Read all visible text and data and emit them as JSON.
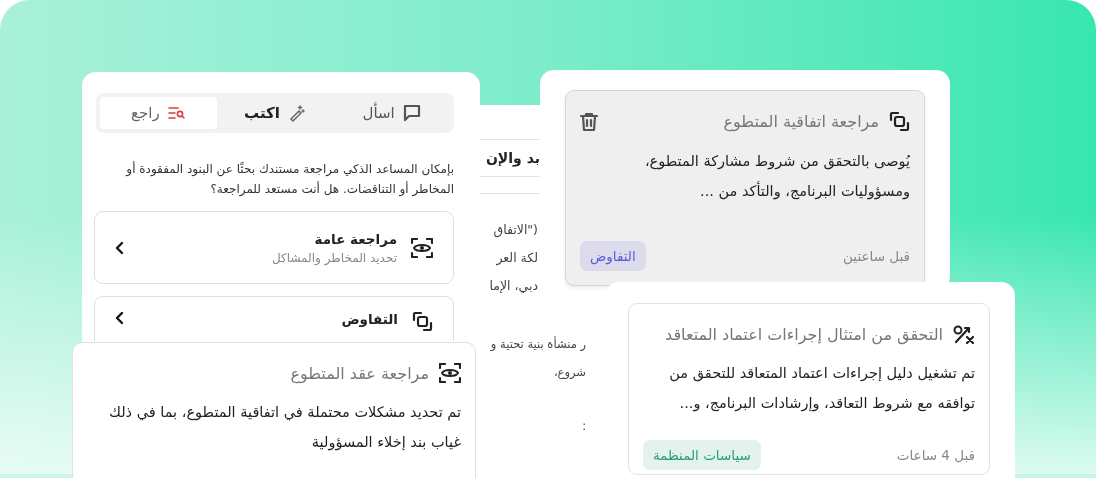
{
  "assistant_panel": {
    "tabs": [
      {
        "label": "اسأل",
        "kind": "chat",
        "selected": false
      },
      {
        "label": "اكتب",
        "kind": "wand",
        "selected": false
      },
      {
        "label": "راجع",
        "kind": "review",
        "selected": true
      }
    ],
    "description": "بإمكان المساعد الذكي مراجعة مستندك بحثًا عن البنود المفقودة أو المخاطر أو التناقضات. هل أنت مستعد للمراجعة؟",
    "options": [
      {
        "title": "مراجعة عامة",
        "subtitle": "تحديد المخاطر والمشاكل",
        "kind": "eye"
      },
      {
        "title": "التفاوض",
        "kind": "link"
      }
    ]
  },
  "document": {
    "heading": "بد والإن",
    "lines": [
      "(\"الاتفاق",
      "لكة العر",
      "دبي، الإما",
      "ر منشأة بنية تحتية و",
      "شروع،",
      ":"
    ]
  },
  "cards": [
    {
      "kind": "link",
      "title": "مراجعة اتفاقية المتطوع",
      "body": "يُوصى بالتحقق من شروط مشاركة المتطوع، ومسؤوليات البرنامج، والتأكد من ...",
      "time": "قبل ساعتين",
      "tag": {
        "label": "التفاوض",
        "color": "#5b5bd6"
      },
      "selected": true,
      "delete_button": true
    },
    {
      "kind": "check",
      "title": "التحقق من امتثال إجراءات اعتماد المتعاقد",
      "body": "تم تشغيل دليل إجراءات اعتماد المتعاقد للتحقق من توافقه مع شروط التعاقد، وإرشادات البرنامج، و...",
      "time": "قبل 4 ساعات",
      "tag": {
        "label": "سياسات المنظمة",
        "color": "#2a9d6f"
      },
      "selected": false,
      "delete_button": false
    },
    {
      "kind": "eye",
      "title": "مراجعة عقد المتطوع",
      "body": "تم تحديد مشكلات محتملة في اتفاقية المتطوع، بما في ذلك غياب بند إخلاء المسؤولية",
      "selected": false,
      "delete_button": false
    }
  ]
}
